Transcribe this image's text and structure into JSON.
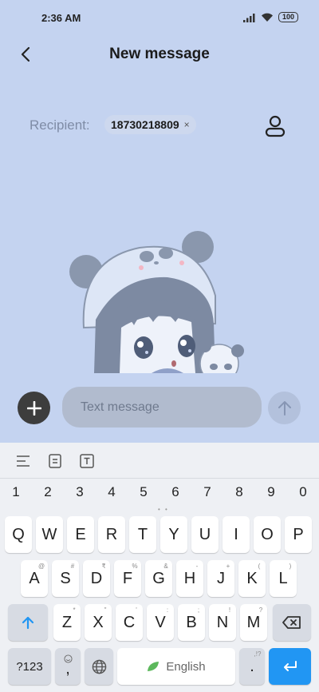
{
  "status_bar": {
    "time": "2:36 AM",
    "battery": "100"
  },
  "header": {
    "title": "New message"
  },
  "recipient": {
    "label": "Recipient:",
    "number": "18730218809",
    "remove_symbol": "×"
  },
  "compose": {
    "placeholder": "Text message"
  },
  "keyboard": {
    "numbers": [
      "1",
      "2",
      "3",
      "4",
      "5",
      "6",
      "7",
      "8",
      "9",
      "0"
    ],
    "row1": [
      "Q",
      "W",
      "E",
      "R",
      "T",
      "Y",
      "U",
      "I",
      "O",
      "P"
    ],
    "row2": [
      {
        "k": "A",
        "s": "@"
      },
      {
        "k": "S",
        "s": "#"
      },
      {
        "k": "D",
        "s": "₹"
      },
      {
        "k": "F",
        "s": "%"
      },
      {
        "k": "G",
        "s": "&"
      },
      {
        "k": "H",
        "s": "-"
      },
      {
        "k": "J",
        "s": "+"
      },
      {
        "k": "K",
        "s": "("
      },
      {
        "k": "L",
        "s": ")"
      }
    ],
    "row3": [
      {
        "k": "Z",
        "s": "*"
      },
      {
        "k": "X",
        "s": "\""
      },
      {
        "k": "C",
        "s": "'"
      },
      {
        "k": "V",
        "s": ":"
      },
      {
        "k": "B",
        "s": ";"
      },
      {
        "k": "N",
        "s": "!"
      },
      {
        "k": "M",
        "s": "?"
      }
    ],
    "symbols_label": "?123",
    "comma": ",",
    "space_label": "English",
    "period": ".",
    "period_sub": ",!?"
  },
  "colors": {
    "background": "#c4d3f0",
    "keyboard_bg": "#eef0f4",
    "accent": "#2196f3"
  }
}
